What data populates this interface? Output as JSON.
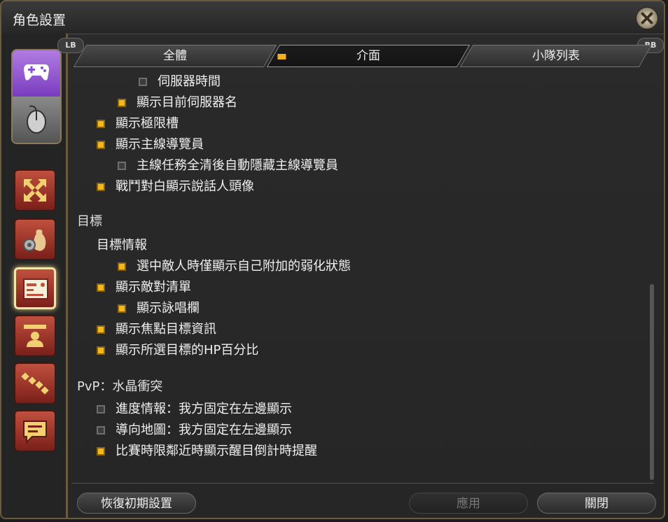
{
  "window": {
    "title": "角色設置"
  },
  "bumpers": {
    "left": "LB",
    "right": "RB"
  },
  "tabs": [
    {
      "label": "全體"
    },
    {
      "label": "介面"
    },
    {
      "label": "小隊列表"
    }
  ],
  "options": {
    "server_time": "伺服器時間",
    "show_server_name": "顯示目前伺服器名",
    "show_limit_gauge": "顯示極限槽",
    "show_scenario_guide": "顯示主線導覽員",
    "hide_guide_after_complete": "主線任務全清後自動隱藏主線導覽員",
    "battle_dialog_portrait": "戰鬥對白顯示說話人頭像",
    "target_section": "目標",
    "target_info": "目標情報",
    "show_own_debuffs_only": "選中敵人時僅顯示自己附加的弱化狀態",
    "show_enmity_list": "顯示敵對清單",
    "show_cast_bar": "顯示詠唱欄",
    "show_focus_target": "顯示焦點目標資訊",
    "show_target_hp_percent": "顯示所選目標的HP百分比",
    "pvp_section": "PvP：水晶衝突",
    "progress_info": "進度情報：我方固定在左邊顯示",
    "navigation_map": "導向地圖：我方固定在左邊顯示",
    "match_end_countdown": "比賽時限鄰近時顯示醒目倒計時提醒"
  },
  "footer": {
    "reset": "恢復初期設置",
    "apply": "應用",
    "close": "關閉"
  }
}
